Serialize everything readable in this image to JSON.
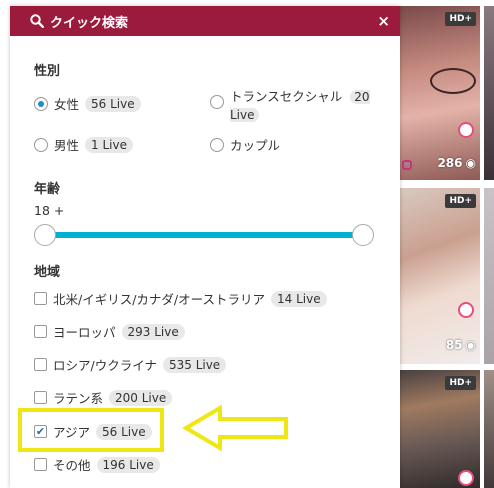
{
  "panel": {
    "title": "クイック検索",
    "close": "×",
    "accent_color": "#9b1b3d"
  },
  "gender": {
    "title": "性別",
    "options": [
      {
        "label": "女性",
        "count": "56 Live",
        "selected": true
      },
      {
        "label": "トランスセクシャル",
        "count": "20 Live",
        "selected": false
      },
      {
        "label": "男性",
        "count": "1 Live",
        "selected": false
      },
      {
        "label": "カップル",
        "count": "",
        "selected": false
      }
    ]
  },
  "age": {
    "title": "年齢",
    "value_label": "18 +",
    "slider_color": "#00b0d0"
  },
  "region": {
    "title": "地域",
    "items": [
      {
        "label": "北米/イギリス/カナダ/オーストラリア",
        "count": "14 Live",
        "checked": false
      },
      {
        "label": "ヨーロッパ",
        "count": "293 Live",
        "checked": false
      },
      {
        "label": "ロシア/ウクライナ",
        "count": "535 Live",
        "checked": false
      },
      {
        "label": "ラテン系",
        "count": "200 Live",
        "checked": false
      },
      {
        "label": "アジア",
        "count": "56 Live",
        "checked": true
      },
      {
        "label": "その他",
        "count": "196 Live",
        "checked": false
      }
    ]
  },
  "thumbnails": [
    {
      "badge": "HD+",
      "viewers": "286"
    },
    {
      "badge": "HD+",
      "viewers": "85"
    },
    {
      "badge": "HD+",
      "viewers": ""
    }
  ],
  "annotation": {
    "highlight_color": "#f0e614"
  }
}
